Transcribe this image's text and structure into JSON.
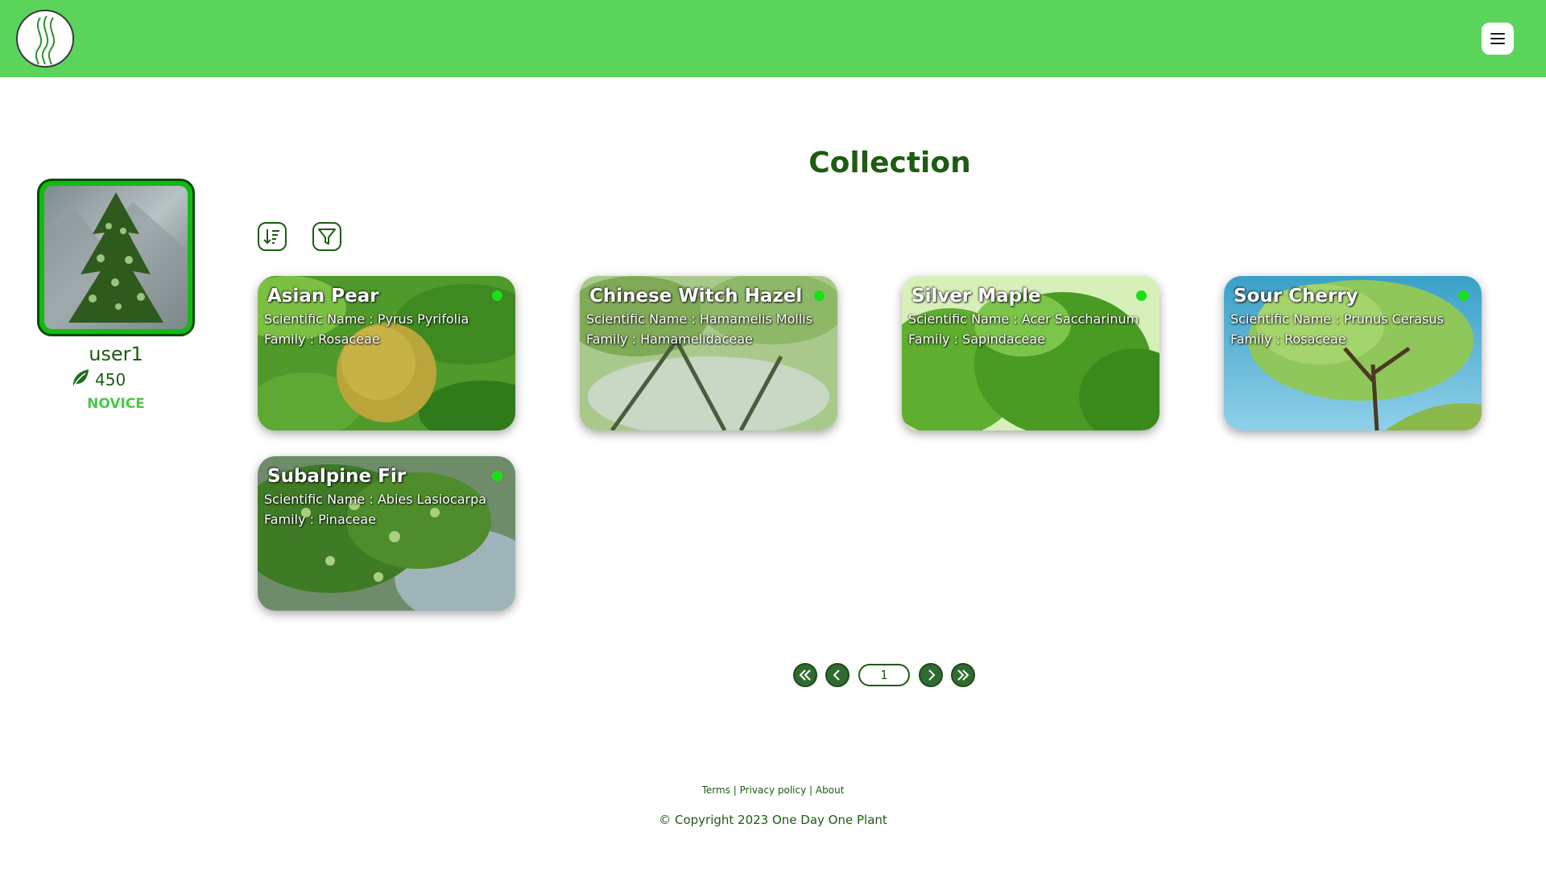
{
  "header": {
    "logo_icon": "leaf-swirl-logo-icon",
    "menu_icon": "hamburger-menu-icon"
  },
  "profile": {
    "username": "user1",
    "points": "450",
    "points_icon": "leaf-icon",
    "rank": "NOVICE"
  },
  "main": {
    "title": "Collection",
    "sort_icon": "sort-icon",
    "filter_icon": "filter-icon",
    "cards": [
      {
        "name": "Asian Pear",
        "scientific_label": "Scientific Name :",
        "scientific": "Pyrus Pyrifolia",
        "family_label": "Family :",
        "family": "Rosaceae",
        "status_color": "#19e019"
      },
      {
        "name": "Chinese Witch Hazel",
        "scientific_label": "Scientific Name :",
        "scientific": "Hamamelis Mollis",
        "family_label": "Family :",
        "family": "Hamamelidaceae",
        "status_color": "#19e019"
      },
      {
        "name": "Silver Maple",
        "scientific_label": "Scientific Name :",
        "scientific": "Acer Saccharinum",
        "family_label": "Family :",
        "family": "Sapindaceae",
        "status_color": "#19e019"
      },
      {
        "name": "Sour Cherry",
        "scientific_label": "Scientific Name :",
        "scientific": "Prunus Cerasus",
        "family_label": "Family :",
        "family": "Rosaceae",
        "status_color": "#19e019"
      },
      {
        "name": "Subalpine Fir",
        "scientific_label": "Scientific Name :",
        "scientific": "Abies Lasiocarpa",
        "family_label": "Family :",
        "family": "Pinaceae",
        "status_color": "#19e019"
      }
    ]
  },
  "pagination": {
    "page": "1"
  },
  "footer": {
    "terms": "Terms",
    "privacy": "Privacy policy",
    "about": "About",
    "sep": "|",
    "copyright": "© Copyright 2023 One Day One Plant"
  },
  "colors": {
    "header": "#5bd45b",
    "accent": "#1d5c12",
    "rank": "#4cc64c"
  }
}
